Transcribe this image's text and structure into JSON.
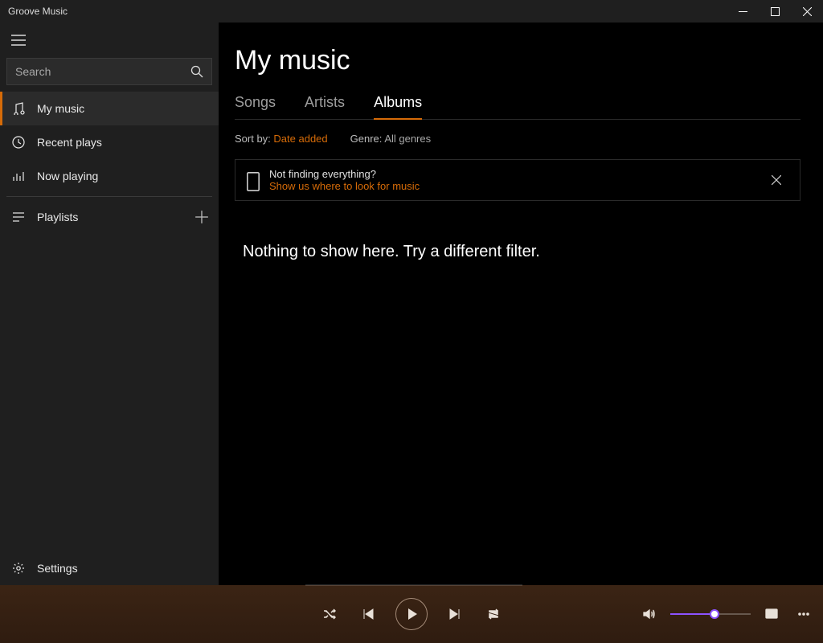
{
  "window": {
    "title": "Groove Music"
  },
  "sidebar": {
    "search_placeholder": "Search",
    "items": [
      {
        "label": "My music"
      },
      {
        "label": "Recent plays"
      },
      {
        "label": "Now playing"
      }
    ],
    "playlists_label": "Playlists",
    "settings_label": "Settings"
  },
  "main": {
    "title": "My music",
    "tabs": [
      {
        "label": "Songs"
      },
      {
        "label": "Artists"
      },
      {
        "label": "Albums"
      }
    ],
    "active_tab": 2,
    "sort_label": "Sort by:",
    "sort_value": "Date added",
    "genre_label": "Genre:",
    "genre_value": "All genres",
    "banner": {
      "line1": "Not finding everything?",
      "line2": "Show us where to look for music"
    },
    "empty_message": "Nothing to show here. Try a different filter."
  },
  "colors": {
    "accent": "#d66b08"
  }
}
